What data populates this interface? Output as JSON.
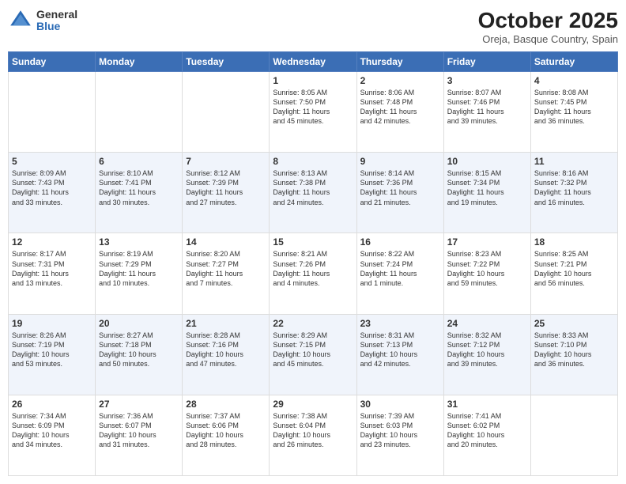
{
  "header": {
    "logo_general": "General",
    "logo_blue": "Blue",
    "month_title": "October 2025",
    "location": "Oreja, Basque Country, Spain"
  },
  "days_of_week": [
    "Sunday",
    "Monday",
    "Tuesday",
    "Wednesday",
    "Thursday",
    "Friday",
    "Saturday"
  ],
  "weeks": [
    [
      {
        "day": "",
        "info": ""
      },
      {
        "day": "",
        "info": ""
      },
      {
        "day": "",
        "info": ""
      },
      {
        "day": "1",
        "info": "Sunrise: 8:05 AM\nSunset: 7:50 PM\nDaylight: 11 hours\nand 45 minutes."
      },
      {
        "day": "2",
        "info": "Sunrise: 8:06 AM\nSunset: 7:48 PM\nDaylight: 11 hours\nand 42 minutes."
      },
      {
        "day": "3",
        "info": "Sunrise: 8:07 AM\nSunset: 7:46 PM\nDaylight: 11 hours\nand 39 minutes."
      },
      {
        "day": "4",
        "info": "Sunrise: 8:08 AM\nSunset: 7:45 PM\nDaylight: 11 hours\nand 36 minutes."
      }
    ],
    [
      {
        "day": "5",
        "info": "Sunrise: 8:09 AM\nSunset: 7:43 PM\nDaylight: 11 hours\nand 33 minutes."
      },
      {
        "day": "6",
        "info": "Sunrise: 8:10 AM\nSunset: 7:41 PM\nDaylight: 11 hours\nand 30 minutes."
      },
      {
        "day": "7",
        "info": "Sunrise: 8:12 AM\nSunset: 7:39 PM\nDaylight: 11 hours\nand 27 minutes."
      },
      {
        "day": "8",
        "info": "Sunrise: 8:13 AM\nSunset: 7:38 PM\nDaylight: 11 hours\nand 24 minutes."
      },
      {
        "day": "9",
        "info": "Sunrise: 8:14 AM\nSunset: 7:36 PM\nDaylight: 11 hours\nand 21 minutes."
      },
      {
        "day": "10",
        "info": "Sunrise: 8:15 AM\nSunset: 7:34 PM\nDaylight: 11 hours\nand 19 minutes."
      },
      {
        "day": "11",
        "info": "Sunrise: 8:16 AM\nSunset: 7:32 PM\nDaylight: 11 hours\nand 16 minutes."
      }
    ],
    [
      {
        "day": "12",
        "info": "Sunrise: 8:17 AM\nSunset: 7:31 PM\nDaylight: 11 hours\nand 13 minutes."
      },
      {
        "day": "13",
        "info": "Sunrise: 8:19 AM\nSunset: 7:29 PM\nDaylight: 11 hours\nand 10 minutes."
      },
      {
        "day": "14",
        "info": "Sunrise: 8:20 AM\nSunset: 7:27 PM\nDaylight: 11 hours\nand 7 minutes."
      },
      {
        "day": "15",
        "info": "Sunrise: 8:21 AM\nSunset: 7:26 PM\nDaylight: 11 hours\nand 4 minutes."
      },
      {
        "day": "16",
        "info": "Sunrise: 8:22 AM\nSunset: 7:24 PM\nDaylight: 11 hours\nand 1 minute."
      },
      {
        "day": "17",
        "info": "Sunrise: 8:23 AM\nSunset: 7:22 PM\nDaylight: 10 hours\nand 59 minutes."
      },
      {
        "day": "18",
        "info": "Sunrise: 8:25 AM\nSunset: 7:21 PM\nDaylight: 10 hours\nand 56 minutes."
      }
    ],
    [
      {
        "day": "19",
        "info": "Sunrise: 8:26 AM\nSunset: 7:19 PM\nDaylight: 10 hours\nand 53 minutes."
      },
      {
        "day": "20",
        "info": "Sunrise: 8:27 AM\nSunset: 7:18 PM\nDaylight: 10 hours\nand 50 minutes."
      },
      {
        "day": "21",
        "info": "Sunrise: 8:28 AM\nSunset: 7:16 PM\nDaylight: 10 hours\nand 47 minutes."
      },
      {
        "day": "22",
        "info": "Sunrise: 8:29 AM\nSunset: 7:15 PM\nDaylight: 10 hours\nand 45 minutes."
      },
      {
        "day": "23",
        "info": "Sunrise: 8:31 AM\nSunset: 7:13 PM\nDaylight: 10 hours\nand 42 minutes."
      },
      {
        "day": "24",
        "info": "Sunrise: 8:32 AM\nSunset: 7:12 PM\nDaylight: 10 hours\nand 39 minutes."
      },
      {
        "day": "25",
        "info": "Sunrise: 8:33 AM\nSunset: 7:10 PM\nDaylight: 10 hours\nand 36 minutes."
      }
    ],
    [
      {
        "day": "26",
        "info": "Sunrise: 7:34 AM\nSunset: 6:09 PM\nDaylight: 10 hours\nand 34 minutes."
      },
      {
        "day": "27",
        "info": "Sunrise: 7:36 AM\nSunset: 6:07 PM\nDaylight: 10 hours\nand 31 minutes."
      },
      {
        "day": "28",
        "info": "Sunrise: 7:37 AM\nSunset: 6:06 PM\nDaylight: 10 hours\nand 28 minutes."
      },
      {
        "day": "29",
        "info": "Sunrise: 7:38 AM\nSunset: 6:04 PM\nDaylight: 10 hours\nand 26 minutes."
      },
      {
        "day": "30",
        "info": "Sunrise: 7:39 AM\nSunset: 6:03 PM\nDaylight: 10 hours\nand 23 minutes."
      },
      {
        "day": "31",
        "info": "Sunrise: 7:41 AM\nSunset: 6:02 PM\nDaylight: 10 hours\nand 20 minutes."
      },
      {
        "day": "",
        "info": ""
      }
    ]
  ]
}
